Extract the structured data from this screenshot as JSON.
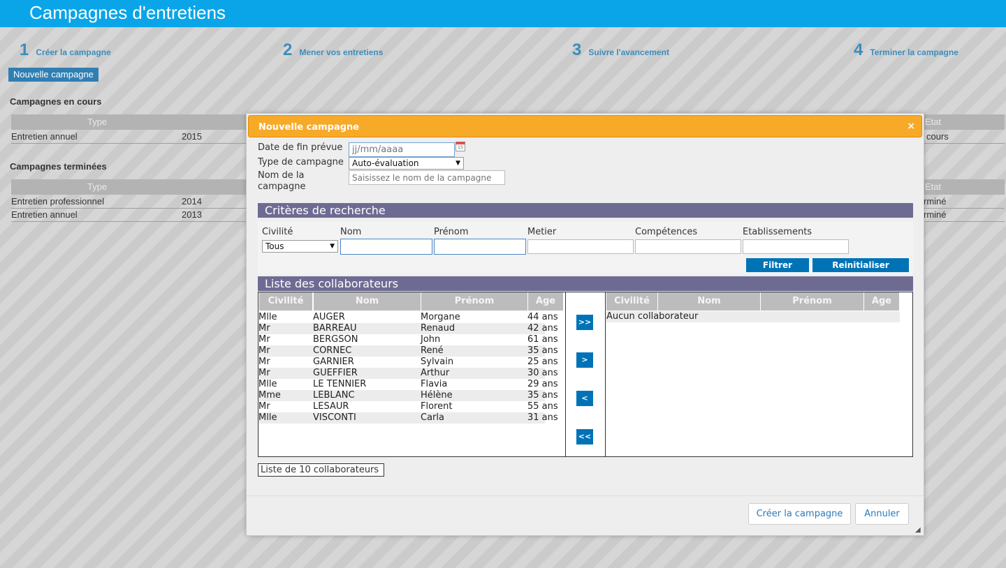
{
  "app": {
    "title": "Campagnes d'entretiens"
  },
  "steps": [
    {
      "num": "1",
      "label": "Créer la campagne"
    },
    {
      "num": "2",
      "label": "Mener vos entretiens"
    },
    {
      "num": "3",
      "label": "Suivre l'avancement"
    },
    {
      "num": "4",
      "label": "Terminer la campagne"
    }
  ],
  "new_campaign_button": "Nouvelle campagne",
  "campaigns_current": {
    "title": "Campagnes en cours",
    "headers": {
      "type": "Type",
      "etat": "Etat"
    },
    "rows": [
      {
        "type": "Entretien annuel",
        "year": "2015",
        "etat": "cours"
      }
    ]
  },
  "campaigns_done": {
    "title": "Campagnes terminées",
    "headers": {
      "type": "Type",
      "etat": "Etat"
    },
    "rows": [
      {
        "type": "Entretien professionnel",
        "year": "2014",
        "etat": "rminé"
      },
      {
        "type": "Entretien annuel",
        "year": "2013",
        "etat": "rminé"
      }
    ]
  },
  "dialog": {
    "title": "Nouvelle campagne",
    "close_icon": "×",
    "form": {
      "date_label": "Date de fin prévue",
      "date_placeholder": "jj/mm/aaaa",
      "calendar_icon": "15",
      "type_label": "Type de campagne",
      "type_value": "Auto-évaluation",
      "name_label_line1": "Nom de la",
      "name_label_line2": "campagne",
      "name_placeholder": "Saisissez le nom de la campagne"
    },
    "criteria": {
      "title": "Critères de recherche",
      "civilite_label": "Civilité",
      "civilite_value": "Tous",
      "nom_label": "Nom",
      "prenom_label": "Prénom",
      "metier_label": "Metier",
      "competences_label": "Compétences",
      "etablissements_label": "Etablissements",
      "filter_button": "Filtrer",
      "reset_button": "Reinitialiser"
    },
    "list": {
      "title": "Liste des collaborateurs",
      "headers": {
        "civilite": "Civilité",
        "nom": "Nom",
        "prenom": "Prénom",
        "age": "Age"
      },
      "rows": [
        {
          "civ": "Mlle",
          "nom": "AUGER",
          "prenom": "Morgane",
          "age": "44 ans"
        },
        {
          "civ": "Mr",
          "nom": "BARREAU",
          "prenom": "Renaud",
          "age": "42 ans"
        },
        {
          "civ": "Mr",
          "nom": "BERGSON",
          "prenom": "John",
          "age": "61 ans"
        },
        {
          "civ": "Mr",
          "nom": "CORNEC",
          "prenom": "René",
          "age": "35 ans"
        },
        {
          "civ": "Mr",
          "nom": "GARNIER",
          "prenom": "Sylvain",
          "age": "25 ans"
        },
        {
          "civ": "Mr",
          "nom": "GUEFFIER",
          "prenom": "Arthur",
          "age": "30 ans"
        },
        {
          "civ": "Mlle",
          "nom": "LE TENNIER",
          "prenom": "Flavia",
          "age": "29 ans"
        },
        {
          "civ": "Mme",
          "nom": "LEBLANC",
          "prenom": "Hélène",
          "age": "35 ans"
        },
        {
          "civ": "Mr",
          "nom": "LESAUR",
          "prenom": "Florent",
          "age": "55 ans"
        },
        {
          "civ": "Mlle",
          "nom": "VISCONTI",
          "prenom": "Carla",
          "age": "31 ans"
        }
      ],
      "move_all_right": ">>",
      "move_right": ">",
      "move_left": "<",
      "move_all_left": "<<",
      "selected_empty": "Aucun collaborateur",
      "count_text": "Liste de 10 collaborateurs"
    },
    "create_button": "Créer la campagne",
    "cancel_button": "Annuler"
  },
  "colors": {
    "topbar": "#0aa5e9",
    "dialog_header": "#f7a928",
    "section_bar": "#6e6b93",
    "button_blue": "#0073b7"
  }
}
